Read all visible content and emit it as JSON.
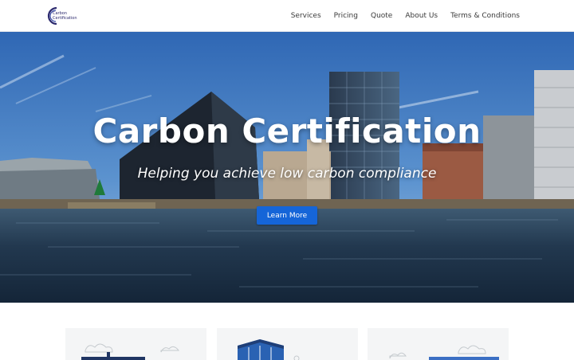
{
  "brand": {
    "logo_text_line1": "Carbon",
    "logo_text_line2": "Certification",
    "accent": "#2c2a6e"
  },
  "nav": {
    "items": [
      "Services",
      "Pricing",
      "Quote",
      "About Us",
      "Terms & Conditions"
    ]
  },
  "hero": {
    "title": "Carbon Certification",
    "subtitle": "Helping you achieve low carbon compliance",
    "cta_label": "Learn More",
    "cta_color": "#1565d8"
  },
  "cards": {
    "count_visible": 3
  }
}
